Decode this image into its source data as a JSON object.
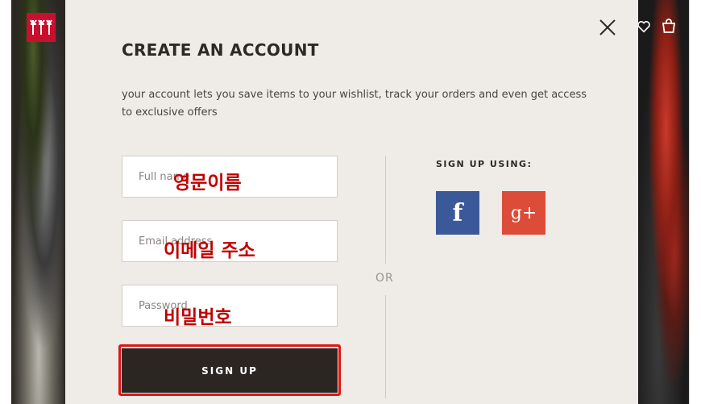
{
  "modal": {
    "title": "CREATE AN ACCOUNT",
    "description": "your account lets you save items to your wishlist, track your orders and even get access to exclusive offers",
    "fields": {
      "full_name": {
        "placeholder": "Full name",
        "overlay": "영문이름"
      },
      "email": {
        "placeholder": "Email address",
        "overlay": "이메일 주소"
      },
      "password": {
        "placeholder": "Password",
        "overlay": "비밀번호"
      }
    },
    "signup_label": "SIGN UP",
    "or_label": "OR",
    "signup_using_label": "SIGN UP USING:",
    "social": {
      "facebook": "f",
      "google_plus": "g+"
    }
  },
  "colors": {
    "modal_bg": "#efebe7",
    "button_bg": "#2b2622",
    "highlight": "#e01515",
    "overlay_text": "#c00000",
    "facebook": "#3b5998",
    "google_plus": "#dd4b39",
    "brand": "#c8102e"
  },
  "icons": [
    "brand-logo-icon",
    "heart-icon",
    "shopping-bag-icon",
    "close-icon",
    "facebook-icon",
    "google-plus-icon"
  ]
}
